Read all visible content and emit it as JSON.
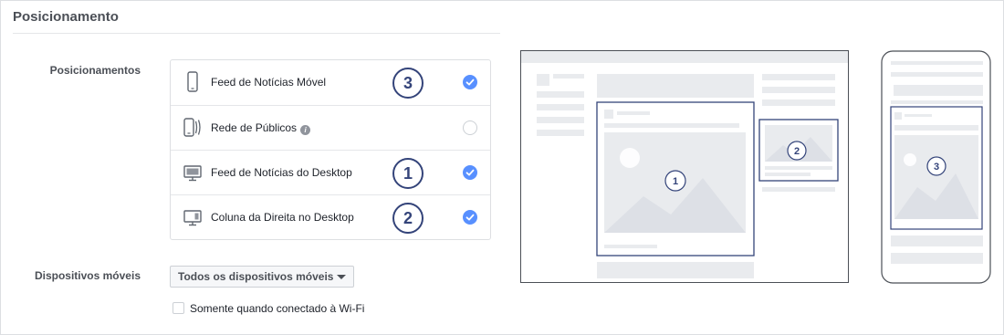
{
  "section": {
    "title": "Posicionamento"
  },
  "placements": {
    "label": "Posicionamentos",
    "items": [
      {
        "label": "Feed de Notícias Móvel",
        "badge": "3",
        "checked": true,
        "icon": "mobile-phone-icon"
      },
      {
        "label": "Rede de Públicos",
        "badge": "",
        "checked": false,
        "icon": "audience-network-icon",
        "info": "i"
      },
      {
        "label": "Feed de Notícias do Desktop",
        "badge": "1",
        "checked": true,
        "icon": "desktop-monitor-icon"
      },
      {
        "label": "Coluna da Direita no Desktop",
        "badge": "2",
        "checked": true,
        "icon": "desktop-column-icon"
      }
    ]
  },
  "devices": {
    "label": "Dispositivos móveis",
    "selected": "Todos os dispositivos móveis",
    "wifi_label": "Somente quando conectado à Wi-Fi"
  },
  "preview": {
    "desktop_markers": [
      "1",
      "2"
    ],
    "mobile_marker": "3"
  },
  "colors": {
    "accent": "#5890ff",
    "badge": "#34447a",
    "frame": "#dddfe2"
  }
}
